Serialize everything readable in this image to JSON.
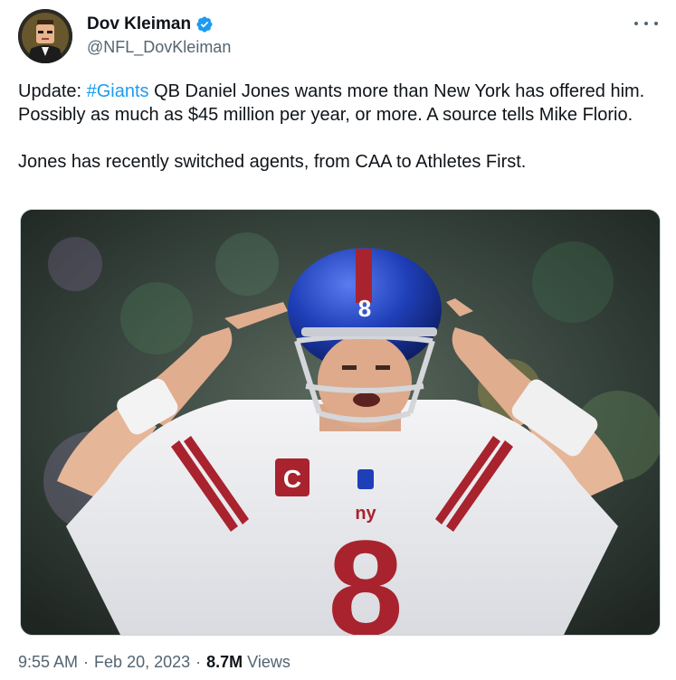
{
  "author": {
    "name": "Dov Kleiman",
    "handle": "@NFL_DovKleiman",
    "avatar_icon": "person-cartoon-avatar-icon",
    "verified": true,
    "verified_color": "#1d9bf0"
  },
  "tweet": {
    "p1_prefix": "Update: ",
    "p1_hashtag": "#Giants",
    "p1_rest": " QB Daniel Jones wants more than New York has offered him. Possibly as much as $45 million per year, or more. A source tells Mike Florio.",
    "p2": "Jones has recently switched agents, from CAA to Athletes First."
  },
  "media": {
    "jersey_number": "8",
    "captain_patch": "C",
    "team_wordmark": "ny"
  },
  "meta": {
    "time": "9:55 AM",
    "separator": "·",
    "date": "Feb 20, 2023",
    "views_count": "8.7M",
    "views_label": "Views"
  },
  "colors": {
    "hashtag": "#1d9bf0",
    "secondary_text": "#536471",
    "giants_blue": "#1f3fb8",
    "giants_red": "#a8232e"
  }
}
